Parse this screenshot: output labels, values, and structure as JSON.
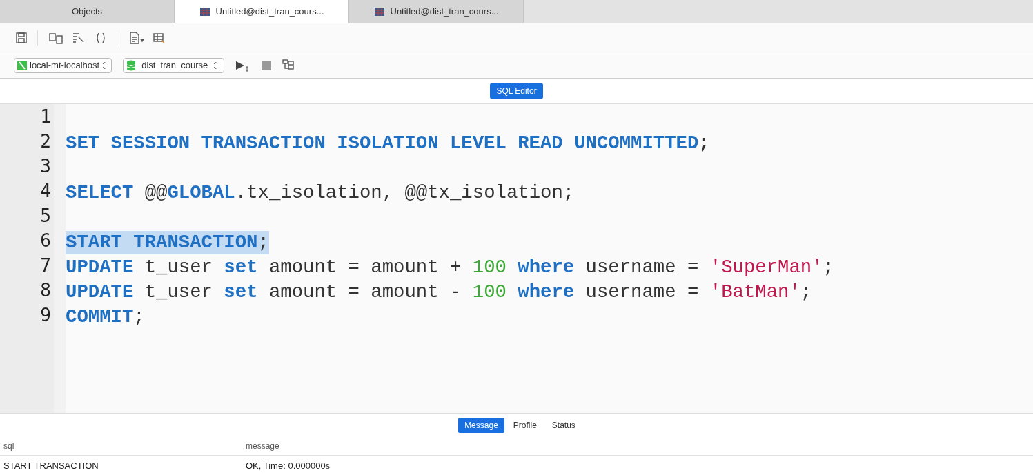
{
  "tabs": [
    {
      "label": "Objects",
      "kind": "plain",
      "selected": false
    },
    {
      "label": "Untitled@dist_tran_cours...",
      "kind": "query",
      "selected": true
    },
    {
      "label": "Untitled@dist_tran_cours...",
      "kind": "query",
      "selected": false
    }
  ],
  "connection": {
    "server": "local-mt-localhost",
    "database": "dist_tran_course"
  },
  "editor_tab": {
    "label": "SQL Editor"
  },
  "code_lines": [
    {
      "number": "1"
    },
    {
      "number": "2",
      "selected": false,
      "tokens": [
        {
          "kind": "kw",
          "text": "SET SESSION TRANSACTION ISOLATION LEVEL READ UNCOMMITTED"
        },
        {
          "kind": "plain",
          "text": ";"
        }
      ]
    },
    {
      "number": "3"
    },
    {
      "number": "4",
      "selected": false,
      "tokens": [
        {
          "kind": "kw",
          "text": "SELECT"
        },
        {
          "kind": "plain",
          "text": " @@"
        },
        {
          "kind": "kw",
          "text": "GLOBAL"
        },
        {
          "kind": "plain",
          "text": ".tx_isolation, @@tx_isolation;"
        }
      ]
    },
    {
      "number": "5"
    },
    {
      "number": "6",
      "selected": true,
      "tokens": [
        {
          "kind": "kw",
          "text": "START TRANSACTION"
        },
        {
          "kind": "plain",
          "text": ";"
        }
      ]
    },
    {
      "number": "7",
      "selected": false,
      "tokens": [
        {
          "kind": "kw",
          "text": "UPDATE"
        },
        {
          "kind": "plain",
          "text": " t_user "
        },
        {
          "kind": "kw",
          "text": "set"
        },
        {
          "kind": "plain",
          "text": " amount = amount + "
        },
        {
          "kind": "num",
          "text": "100"
        },
        {
          "kind": "kw",
          "text": " where"
        },
        {
          "kind": "plain",
          "text": " username = "
        },
        {
          "kind": "str",
          "text": "'SuperMan'"
        },
        {
          "kind": "plain",
          "text": ";"
        }
      ]
    },
    {
      "number": "8",
      "selected": false,
      "tokens": [
        {
          "kind": "kw",
          "text": "UPDATE"
        },
        {
          "kind": "plain",
          "text": " t_user "
        },
        {
          "kind": "kw",
          "text": "set"
        },
        {
          "kind": "plain",
          "text": " amount = amount - "
        },
        {
          "kind": "num",
          "text": "100"
        },
        {
          "kind": "kw",
          "text": " where"
        },
        {
          "kind": "plain",
          "text": " username = "
        },
        {
          "kind": "str",
          "text": "'BatMan'"
        },
        {
          "kind": "plain",
          "text": ";"
        }
      ]
    },
    {
      "number": "9",
      "selected": false,
      "tokens": [
        {
          "kind": "kw",
          "text": "COMMIT"
        },
        {
          "kind": "plain",
          "text": ";"
        }
      ]
    }
  ],
  "result_tabs": [
    {
      "label": "Message",
      "selected": true
    },
    {
      "label": "Profile",
      "selected": false
    },
    {
      "label": "Status",
      "selected": false
    }
  ],
  "result_table": {
    "columns": [
      "sql",
      "message"
    ],
    "rows": [
      [
        "START TRANSACTION",
        "OK, Time: 0.000000s"
      ]
    ]
  }
}
